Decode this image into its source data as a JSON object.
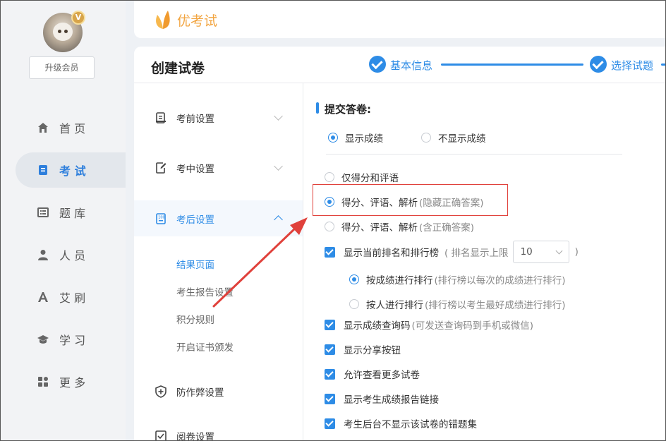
{
  "sidebar": {
    "badge": "V",
    "upgrade_label": "升级会员",
    "items": [
      {
        "label": "首 页",
        "icon": "home-icon"
      },
      {
        "label": "考 试",
        "icon": "exam-book-icon"
      },
      {
        "label": "题 库",
        "icon": "question-bank-icon"
      },
      {
        "label": "人 员",
        "icon": "person-icon"
      },
      {
        "label": "艾 刷",
        "icon": "letter-a-icon"
      },
      {
        "label": "学 习",
        "icon": "graduation-cap-icon"
      },
      {
        "label": "更 多",
        "icon": "grid-more-icon"
      }
    ],
    "active_index": 1
  },
  "header": {
    "brand": "优考试"
  },
  "card": {
    "title": "创建试卷",
    "steps": [
      {
        "label": "基本信息",
        "done": true
      },
      {
        "label": "选择试题",
        "done": true
      }
    ]
  },
  "settings_menu": {
    "groups": [
      {
        "label": "考前设置",
        "icon": "clipboard-icon"
      },
      {
        "label": "考中设置",
        "icon": "edit-doc-icon"
      },
      {
        "label": "考后设置",
        "icon": "score-doc-icon"
      }
    ],
    "subitems": [
      {
        "label": "结果页面",
        "active": true
      },
      {
        "label": "考生报告设置",
        "active": false
      },
      {
        "label": "积分规则",
        "active": false
      },
      {
        "label": "开启证书颁发",
        "active": false
      }
    ],
    "anti_cheat": {
      "label": "防作弊设置",
      "icon": "shield-icon"
    },
    "marking": {
      "label": "阅卷设置",
      "icon": "marking-icon"
    }
  },
  "content": {
    "section_title": "提交答卷:",
    "score_display": {
      "show": "显示成绩",
      "hide": "不显示成绩",
      "selected": "show"
    },
    "result_options": [
      {
        "label": "仅得分和评语",
        "hint": "",
        "selected": false
      },
      {
        "label": "得分、评语、解析",
        "hint": "(隐藏正确答案)",
        "selected": true
      },
      {
        "label": "得分、评语、解析",
        "hint": "(含正确答案)",
        "selected": false
      }
    ],
    "ranking": {
      "label": "显示当前排名和排行榜",
      "limit_label": "( 排名显示上限",
      "limit_value": "10",
      "close_paren": ")",
      "by_score": {
        "label": "按成绩进行排行",
        "hint": "(排行榜以每次的成绩进行排行)",
        "selected": true
      },
      "by_person": {
        "label": "按人进行排行",
        "hint": "(排行榜以考生最好成绩进行排行)",
        "selected": false
      }
    },
    "checkboxes": [
      {
        "label": "显示成绩查询码",
        "hint": "(可发送查询码到手机或微信)"
      },
      {
        "label": "显示分享按钮",
        "hint": ""
      },
      {
        "label": "允许查看更多试卷",
        "hint": ""
      },
      {
        "label": "显示考生成绩报告链接",
        "hint": ""
      },
      {
        "label": "考生后台不显示该试卷的错题集",
        "hint": ""
      }
    ]
  },
  "colors": {
    "accent": "#2e8ce6",
    "brand": "#f2a541",
    "annotation": "#e0413b"
  }
}
